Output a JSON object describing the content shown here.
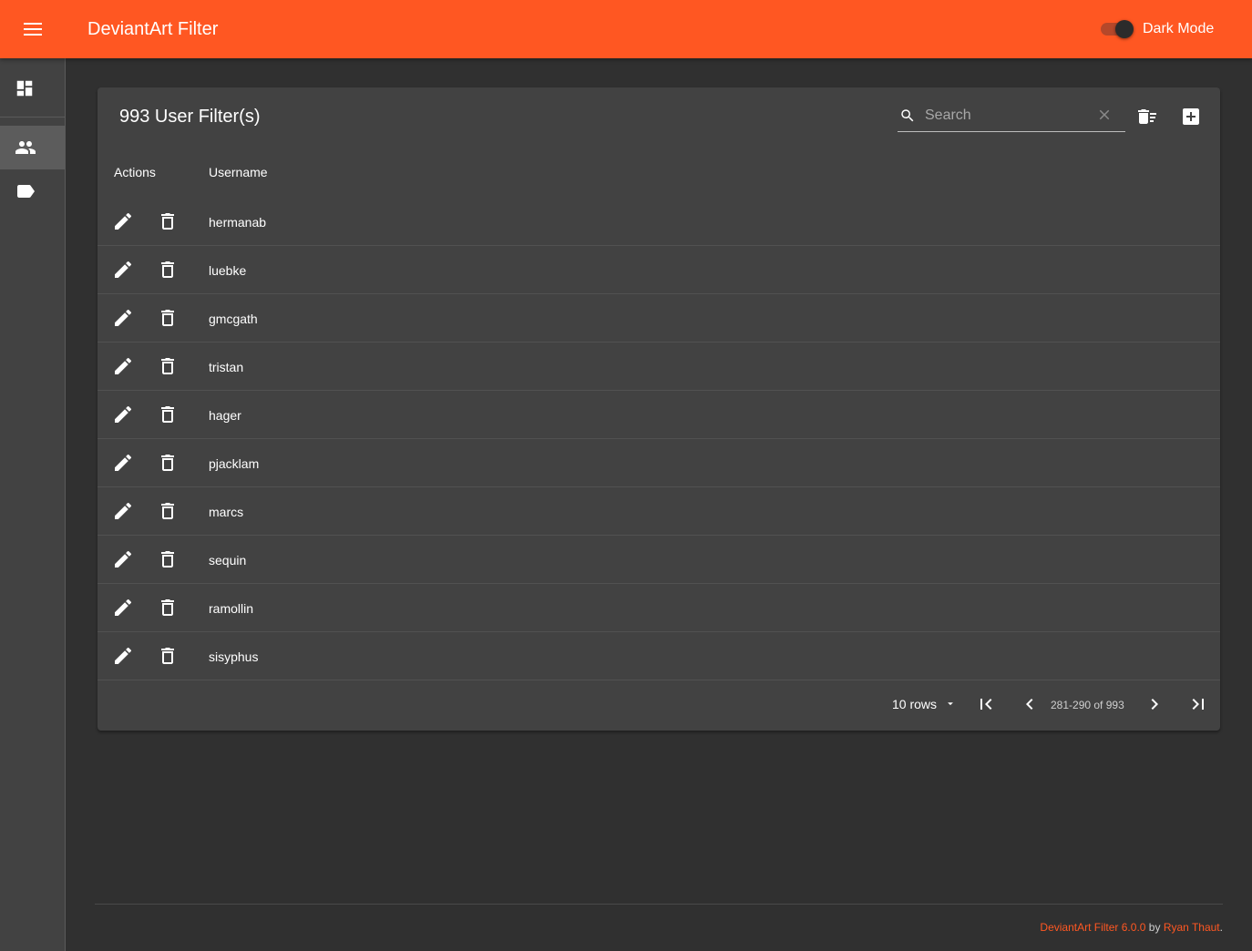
{
  "appbar": {
    "title": "DeviantArt Filter",
    "dark_mode_label": "Dark Mode",
    "dark_mode_on": true,
    "accent_color": "#ff5722"
  },
  "sidebar": {
    "items": [
      {
        "icon": "dashboard-icon",
        "active": false
      },
      {
        "icon": "users-icon",
        "active": true
      },
      {
        "icon": "tag-icon",
        "active": false
      }
    ]
  },
  "card": {
    "title": "993 User Filter(s)",
    "search": {
      "placeholder": "Search",
      "value": ""
    },
    "columns": [
      "Actions",
      "Username"
    ],
    "rows": [
      "hermanab",
      "luebke",
      "gmcgath",
      "tristan",
      "hager",
      "pjacklam",
      "marcs",
      "sequin",
      "ramollin",
      "sisyphus"
    ]
  },
  "pagination": {
    "rows_label": "10 rows",
    "range": "281-290 of 993"
  },
  "footer": {
    "app_version": "DeviantArt Filter 6.0.0",
    "by": "by",
    "author": "Ryan Thaut",
    "period": "."
  }
}
